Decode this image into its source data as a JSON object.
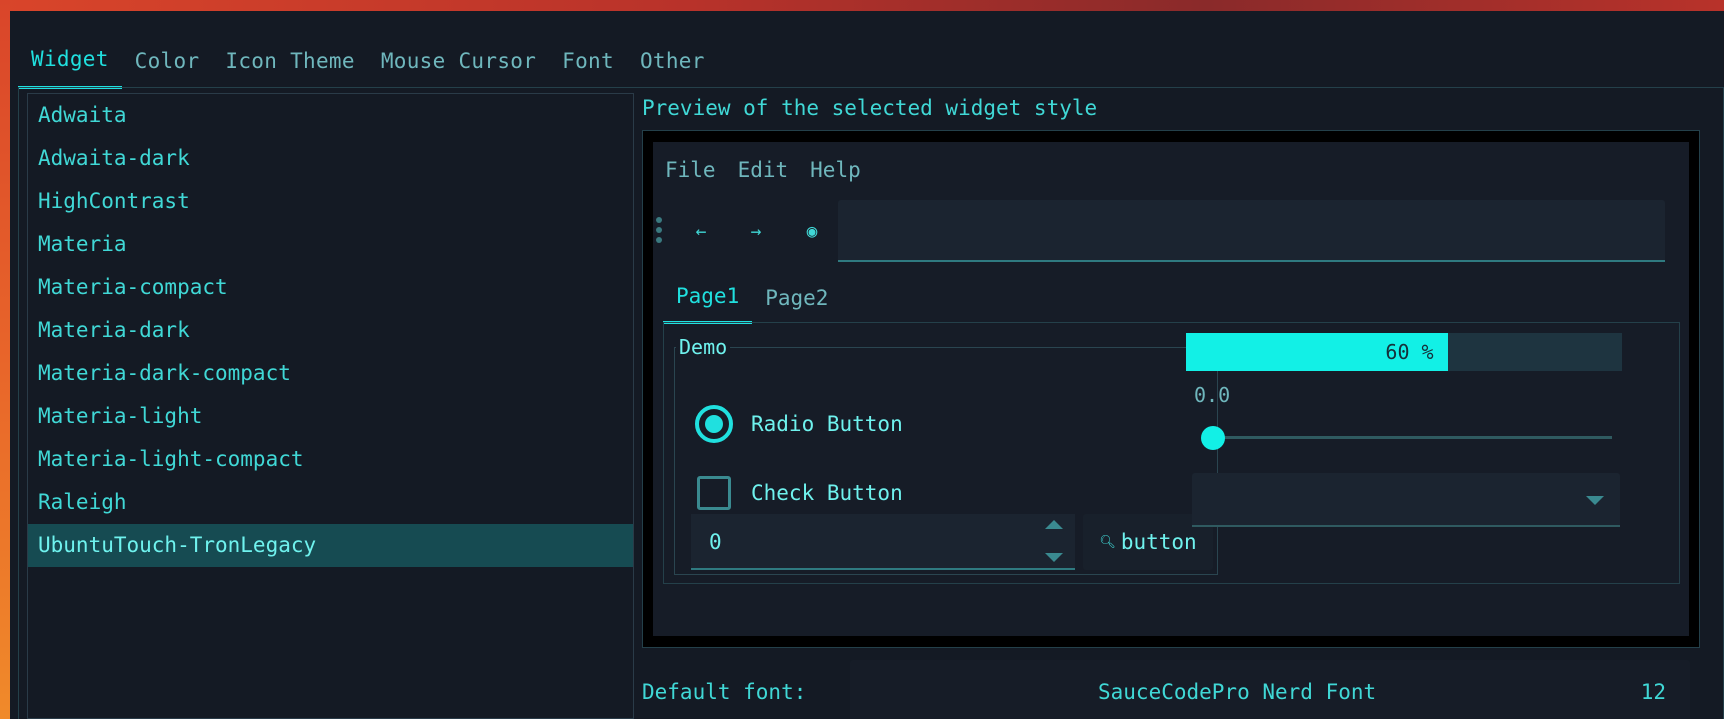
{
  "tabs": [
    {
      "label": "Widget"
    },
    {
      "label": "Color"
    },
    {
      "label": "Icon Theme"
    },
    {
      "label": "Mouse Cursor"
    },
    {
      "label": "Font"
    },
    {
      "label": "Other"
    }
  ],
  "theme_list": [
    "Adwaita",
    "Adwaita-dark",
    "HighContrast",
    "Materia",
    "Materia-compact",
    "Materia-dark",
    "Materia-dark-compact",
    "Materia-light",
    "Materia-light-compact",
    "Raleigh",
    "UbuntuTouch-TronLegacy"
  ],
  "selected_theme": "UbuntuTouch-TronLegacy",
  "preview": {
    "title": "Preview of the selected widget style",
    "menu": [
      "File",
      "Edit",
      "Help"
    ],
    "toolbar": {
      "back": "←",
      "forward": "→",
      "record": "◉"
    },
    "notebook_tabs": [
      "Page1",
      "Page2"
    ],
    "demo_label": "Demo",
    "radio_label": "Radio Button",
    "check_label": "Check Button",
    "spin_value": "0",
    "button_label": "button",
    "progress_text": "60 %",
    "progress_fraction": 0.6,
    "scale_value": "0.0"
  },
  "font": {
    "label": "Default font:",
    "name": "SauceCodePro Nerd Font",
    "size": "12"
  },
  "colors": {
    "accent": "#20e0df",
    "background": "#141a24",
    "selection": "#164b52"
  }
}
